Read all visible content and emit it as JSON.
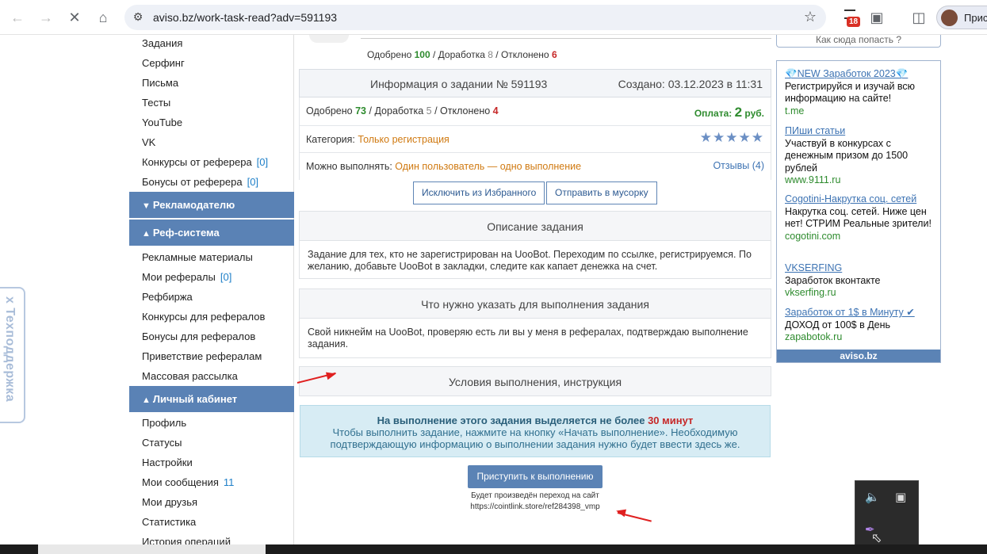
{
  "browser": {
    "url": "aviso.bz/work-task-read?adv=591193",
    "badge_count": "18",
    "profile_name": "Прис"
  },
  "sidebar": {
    "links_top": [
      {
        "label": "Задания"
      },
      {
        "label": "Серфинг"
      },
      {
        "label": "Письма"
      },
      {
        "label": "Тесты"
      },
      {
        "label": "YouTube"
      },
      {
        "label": "VK"
      },
      {
        "label": "Конкурсы от реферера",
        "count": "[0]"
      },
      {
        "label": "Бонусы от реферера",
        "count": "[0]"
      }
    ],
    "section_advertiser": "Рекламодателю",
    "section_ref": "Реф-система",
    "links_ref": [
      {
        "label": "Рекламные материалы"
      },
      {
        "label": "Мои рефералы",
        "count": "[0]"
      },
      {
        "label": "Рефбиржа"
      },
      {
        "label": "Конкурсы для рефералов"
      },
      {
        "label": "Бонусы для рефералов"
      },
      {
        "label": "Приветствие рефералам"
      },
      {
        "label": "Массовая рассылка"
      }
    ],
    "section_cabinet": "Личный кабинет",
    "links_cabinet": [
      {
        "label": "Профиль"
      },
      {
        "label": "Статусы"
      },
      {
        "label": "Настройки"
      },
      {
        "label": "Мои сообщения",
        "count": "11"
      },
      {
        "label": "Мои друзья"
      },
      {
        "label": "Статистика"
      },
      {
        "label": "История операций"
      }
    ]
  },
  "help_tab": {
    "close": "x",
    "label": "Техподдержка"
  },
  "task": {
    "top_stats": {
      "approved_label": "Одобрено",
      "approved": "100",
      "rework_label": "Доработка",
      "rework": "8",
      "rejected_label": "Отклонено",
      "rejected": "6"
    },
    "title": "Информация о задании № 591193",
    "created": "Создано: 03.12.2023 в 11:31",
    "stats": {
      "approved_label": "Одобрено",
      "approved": "73",
      "rework_label": "Доработка",
      "rework": "5",
      "rejected_label": "Отклонено",
      "rejected": "4"
    },
    "pay_label": "Оплата:",
    "pay_value": "2",
    "pay_unit": "руб.",
    "category_label": "Категория:",
    "category": "Только регистрация",
    "rating_stars": 5,
    "can_do_label": "Можно выполнять:",
    "can_do": "Один пользователь — одно выполнение",
    "reviews": "Отзывы (4)",
    "btn_exclude": "Исключить из Избранного",
    "btn_trash": "Отправить в мусорку",
    "desc_title": "Описание задания",
    "desc_text": "Задание для тех, кто не зарегистрирован на UooBot. Переходим по ссылке, регистрируемся. По желанию, добавьте UooBot в закладки, следите как капает денежка на счет.",
    "report_title": "Что нужно указать для выполнения задания",
    "report_text": "Свой никнейм на UooBot, проверяю есть ли вы у меня в рефералах, подтверждаю выполнение задания.",
    "conditions_title": "Условия выполнения, инструкция",
    "notice_bold": "На выполнение этого задания выделяется не более",
    "notice_time": "30 минут",
    "notice_text": "Чтобы выполнить задание, нажмите на кнопку «Начать выполнение». Необходимую подтверждающую информацию о выполнении задания нужно будет ввести здесь же.",
    "start_btn": "Приступить к выполнению",
    "redirect_label": "Будет произведён переход на сайт",
    "redirect_url": "https://cointlink.store/ref284398_vmp"
  },
  "ads": {
    "top_cut": "Как сюда попасть ?",
    "items": [
      {
        "title": "💎NEW Заработок 2023💎",
        "desc": "Регистрируйся и изучай всю информацию на сайте!",
        "url": "t.me"
      },
      {
        "title": "ПИши статьи",
        "desc": "Участвуй в конкурсах с денежным призом до 1500 рублей",
        "url": "www.9111.ru"
      },
      {
        "title": "Cogotini-Накрутка соц. сетей",
        "desc": "Накрутка соц. сетей. Ниже цен нет! СТРИМ Реальные зрители!",
        "url": "cogotini.com"
      },
      {
        "title": "VKSERFING",
        "desc": "Заработок вконтакте",
        "url": "vkserfing.ru"
      },
      {
        "title": "Заработок от 1$ в Минуту ✔",
        "desc": "ДОХОД от 100$ в День",
        "url": "zapabotok.ru"
      }
    ],
    "footer": "aviso.bz"
  }
}
